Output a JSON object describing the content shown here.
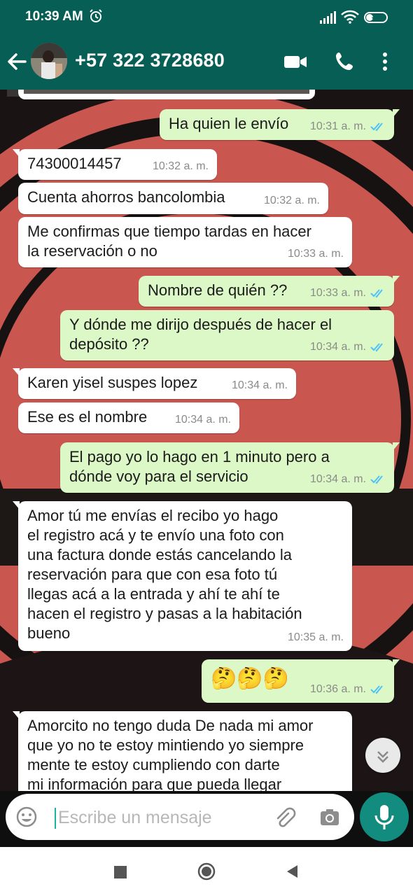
{
  "status": {
    "time": "10:39 AM",
    "battery": "32"
  },
  "header": {
    "contact": "+57 322 3728680"
  },
  "messages": [
    {
      "dir": "out",
      "text": "Ha quien le envío",
      "time": "10:31 a. m."
    },
    {
      "dir": "in",
      "text": "74300014457",
      "time": "10:32 a. m."
    },
    {
      "dir": "in",
      "text": "Cuenta ahorros bancolombia",
      "time": "10:32 a. m."
    },
    {
      "dir": "in",
      "text": "Me confirmas que tiempo tardas en hacer\nla reservación o no",
      "time": "10:33 a. m."
    },
    {
      "dir": "out",
      "text": "Nombre de quién ??",
      "time": "10:33 a. m."
    },
    {
      "dir": "out",
      "text": "Y dónde me dirijo después de hacer el\ndepósito ??",
      "time": "10:34 a. m."
    },
    {
      "dir": "in",
      "text": "Karen yisel suspes lopez",
      "time": "10:34 a. m."
    },
    {
      "dir": "in",
      "text": "Ese es el nombre",
      "time": "10:34 a. m."
    },
    {
      "dir": "out",
      "text": "El pago yo lo hago en 1 minuto pero a\ndónde voy para el servicio",
      "time": "10:34 a. m."
    },
    {
      "dir": "in",
      "text": "Amor tú me envías el recibo yo hago\nel registro acá y te envío una foto con\nuna factura donde estás cancelando la\nreservación para que con esa foto tú\nllegas acá a la entrada y ahí te ahí te\nhacen el registro y pasas a la habitación\nbueno",
      "time": "10:35 a. m."
    },
    {
      "dir": "out",
      "text": "🤔🤔🤔",
      "time": "10:36 a. m."
    },
    {
      "dir": "in",
      "text": "Amorcito no tengo duda De nada mi amor\nque yo no te estoy mintiendo yo siempre\nmente te estoy cumpliendo con darte\nmi información para que pueda llegar",
      "time": ""
    }
  ],
  "input": {
    "placeholder": "Escribe un mensaje"
  },
  "colors": {
    "header": "#075e54",
    "out_bubble": "#dcf8c6",
    "in_bubble": "#ffffff",
    "read_ticks": "#4fc3f7",
    "fab": "#128c7e"
  },
  "icons": [
    "back-arrow-icon",
    "video-call-icon",
    "phone-call-icon",
    "more-options-icon",
    "alarm-icon",
    "signal-icon",
    "wifi-icon",
    "emoji-icon",
    "attach-icon",
    "camera-icon",
    "mic-icon",
    "scroll-down-icon"
  ]
}
